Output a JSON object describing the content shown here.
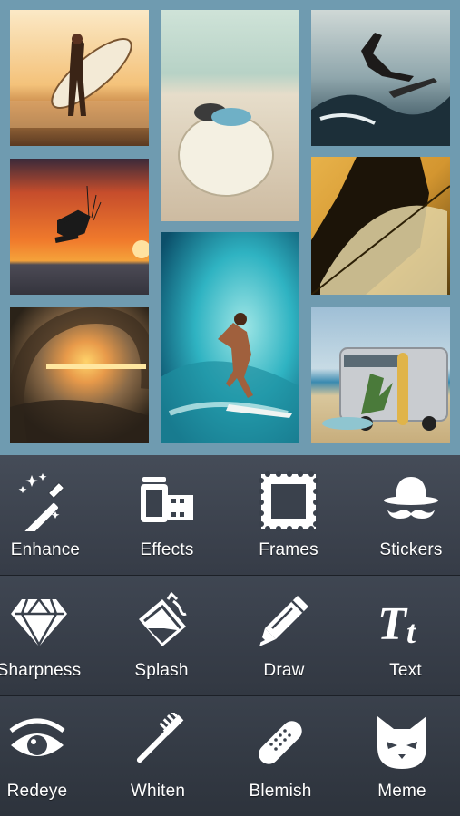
{
  "collage": {
    "photos": [
      {
        "name": "surfer-girl-sunset"
      },
      {
        "name": "surfboard-on-sand"
      },
      {
        "name": "surfer-jump"
      },
      {
        "name": "kitesurfer-red-sky"
      },
      {
        "name": "surfer-in-wave"
      },
      {
        "name": "surfer-silhouette-board"
      },
      {
        "name": "wave-tunnel-sunset"
      },
      {
        "name": "camper-van-beach"
      }
    ]
  },
  "tools": {
    "row1": [
      {
        "label": "Enhance",
        "icon": "magic-wand-icon"
      },
      {
        "label": "Effects",
        "icon": "film-roll-icon"
      },
      {
        "label": "Frames",
        "icon": "stamp-frame-icon"
      },
      {
        "label": "Stickers",
        "icon": "hat-mustache-icon"
      }
    ],
    "row2": [
      {
        "label": "Sharpness",
        "icon": "diamond-icon"
      },
      {
        "label": "Splash",
        "icon": "paint-bucket-icon"
      },
      {
        "label": "Draw",
        "icon": "pencil-icon"
      },
      {
        "label": "Text",
        "icon": "text-tt-icon"
      }
    ],
    "row3": [
      {
        "label": "Redeye",
        "icon": "eye-icon"
      },
      {
        "label": "Whiten",
        "icon": "toothbrush-icon"
      },
      {
        "label": "Blemish",
        "icon": "bandage-icon"
      },
      {
        "label": "Meme",
        "icon": "cat-face-icon"
      }
    ]
  },
  "colors": {
    "collage_border": "#6f9bb0",
    "toolbar_bg": "#363c47",
    "label": "#ffffff"
  }
}
